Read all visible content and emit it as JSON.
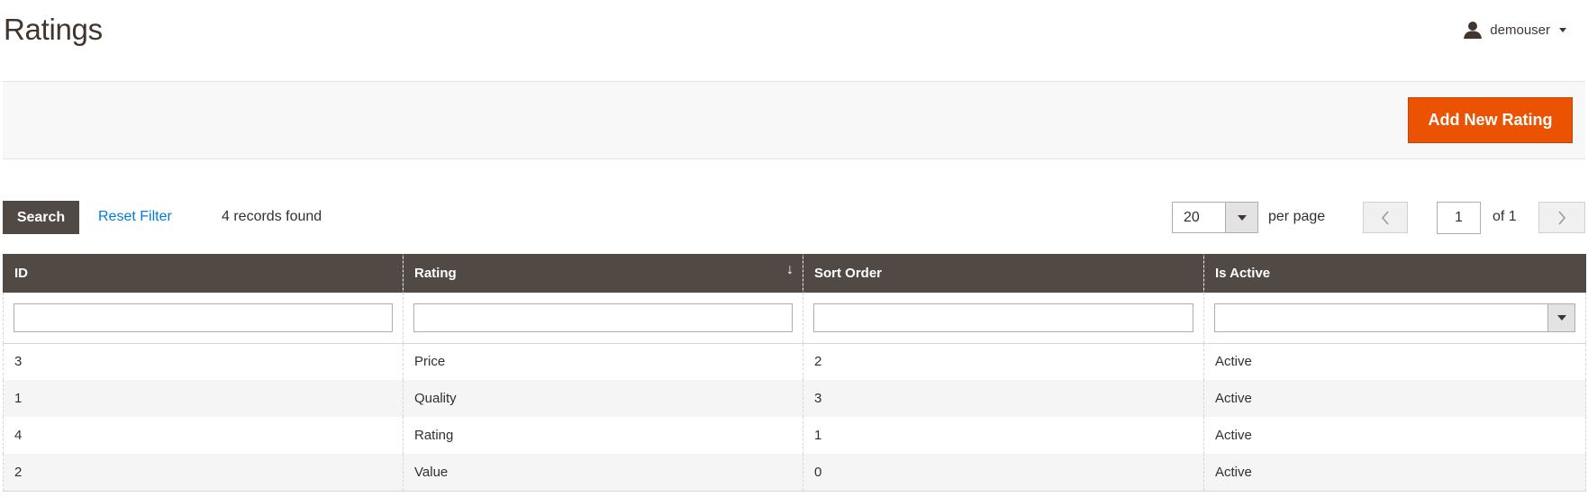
{
  "header": {
    "title": "Ratings",
    "user_name": "demouser"
  },
  "actions": {
    "add_label": "Add New Rating"
  },
  "toolbar": {
    "search_label": "Search",
    "reset_label": "Reset Filter",
    "records_found": "4 records found",
    "per_page_value": "20",
    "per_page_label": "per page",
    "current_page": "1",
    "page_total": "of 1"
  },
  "grid": {
    "columns": [
      "ID",
      "Rating",
      "Sort Order",
      "Is Active"
    ],
    "sort_indicator": "↓",
    "rows": [
      {
        "id": "3",
        "rating": "Price",
        "sort_order": "2",
        "is_active": "Active"
      },
      {
        "id": "1",
        "rating": "Quality",
        "sort_order": "3",
        "is_active": "Active"
      },
      {
        "id": "4",
        "rating": "Rating",
        "sort_order": "1",
        "is_active": "Active"
      },
      {
        "id": "2",
        "rating": "Value",
        "sort_order": "0",
        "is_active": "Active"
      }
    ]
  },
  "colors": {
    "accent": "#eb5202",
    "header_dark": "#514943",
    "link": "#007bdb"
  },
  "icons": {
    "user": "user-icon",
    "caret": "chevron-down-icon",
    "prev": "chevron-left-icon",
    "next": "chevron-right-icon"
  }
}
